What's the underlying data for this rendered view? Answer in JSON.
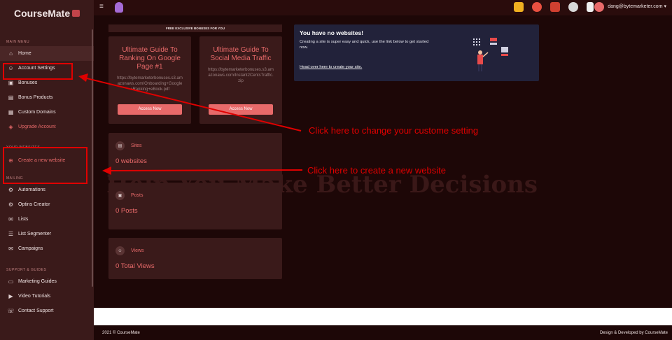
{
  "brand": {
    "name": "CourseMate"
  },
  "sidebar": {
    "sections": {
      "main": "MAIN MENU",
      "websites": "YOUR WEBSITES",
      "mailing": "MAILING",
      "support": "SUPPORT & GUIDES"
    },
    "main_items": [
      {
        "label": "Home",
        "icon": "home-icon"
      },
      {
        "label": "Account Settings",
        "icon": "user-icon"
      },
      {
        "label": "Bonuses",
        "icon": "gift-icon"
      },
      {
        "label": "Bonus Products",
        "icon": "box-icon"
      },
      {
        "label": "Custom Domains",
        "icon": "domain-icon"
      },
      {
        "label": "Upgrade Account",
        "icon": "shield-icon"
      }
    ],
    "website_items": [
      {
        "label": "Create a new website",
        "icon": "plus-circle-icon"
      }
    ],
    "mailing_items": [
      {
        "label": "Automations",
        "icon": "gear-icon"
      },
      {
        "label": "Optins Creator",
        "icon": "gear-icon"
      },
      {
        "label": "Lists",
        "icon": "mail-icon"
      },
      {
        "label": "List Segmenter",
        "icon": "list-icon"
      },
      {
        "label": "Campaigns",
        "icon": "mail-icon"
      }
    ],
    "support_items": [
      {
        "label": "Marketing Guides",
        "icon": "guide-icon"
      },
      {
        "label": "Video Tutorials",
        "icon": "video-icon"
      },
      {
        "label": "Contact Support",
        "icon": "headset-icon"
      }
    ]
  },
  "topbar": {
    "user_email": "dang@bytemarketer.com",
    "icons": [
      "popcorn-icon",
      "person-icon",
      "film-icon",
      "badge-icon",
      "award-icon"
    ]
  },
  "bonuses": {
    "header": "FREE EXCLUSIVE BONUSES FOR YOU",
    "cards": [
      {
        "title": "Ultimate Guide To Ranking On Google Page #1",
        "url": "https://bytemarketerbonuses.s3.amazonaws.com/Onboarding+Google+Ranking+eBook.pdf",
        "button": "Access Now"
      },
      {
        "title": "Ultimate Guide To Social Media Traffic",
        "url": "https://bytemarketerbonuses.s3.amazonaws.com/Instant2CentsTraffic.zip",
        "button": "Access Now"
      }
    ]
  },
  "stats": [
    {
      "label": "Sites",
      "value": "0 websites",
      "icon": "layers-icon"
    },
    {
      "label": "Posts",
      "value": "0 Posts",
      "icon": "post-icon"
    },
    {
      "label": "Views",
      "value": "0 Total Views",
      "icon": "user-icon"
    }
  ],
  "nosite": {
    "title": "You have no websites!",
    "text": "Creating a site is super easy and quick, use the link below to get started now.",
    "link": "Head over here to create your site."
  },
  "watermark": "Help You Make Better Decisions",
  "annotations": {
    "settings": "Click here to change your custome setting",
    "website": "Click here to create a new website"
  },
  "footer": {
    "left": "2021 © CourseMate",
    "right": "Design & Developed by CourseMate"
  },
  "colors": {
    "accent": "#e86a6a",
    "sidebar": "#3a1a1a",
    "background": "#1d0707",
    "card": "#3a1a1a",
    "panel": "#22223a",
    "annotation": "#e00000"
  }
}
